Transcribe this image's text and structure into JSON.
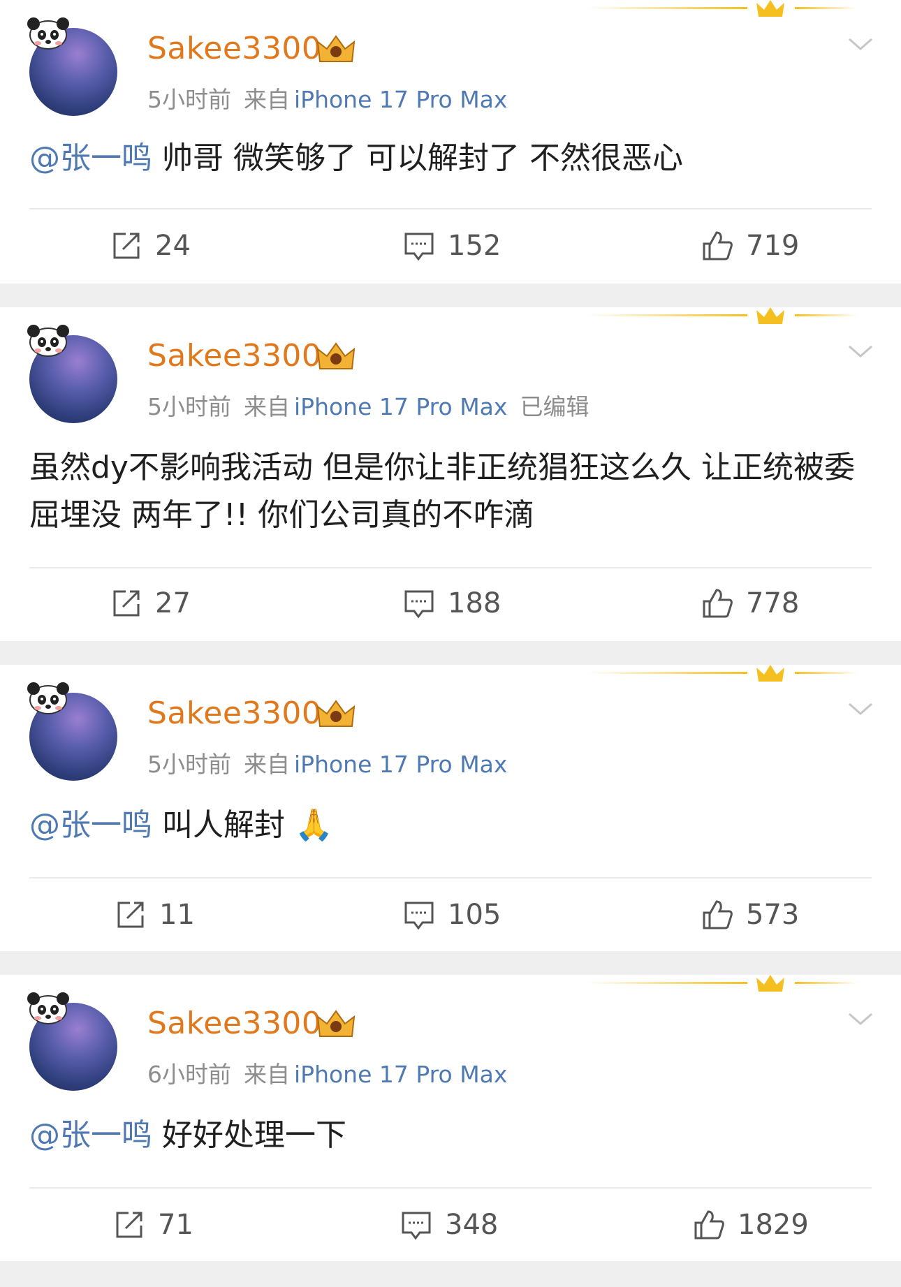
{
  "posts": [
    {
      "username": "Sakee3300",
      "time": "5小时前",
      "source_prefix": "来自",
      "device": "iPhone 17 Pro Max",
      "edited": "",
      "mention": "@张一鸣",
      "text": " 帅哥 微笑够了 可以解封了 不然很恶心",
      "reposts": "24",
      "comments": "152",
      "likes": "719"
    },
    {
      "username": "Sakee3300",
      "time": "5小时前",
      "source_prefix": "来自",
      "device": "iPhone 17 Pro Max",
      "edited": "已编辑",
      "mention": "",
      "text": "虽然dy不影响我活动 但是你让非正统猖狂这么久 让正统被委屈埋没 两年了!! 你们公司真的不咋滴",
      "reposts": "27",
      "comments": "188",
      "likes": "778"
    },
    {
      "username": "Sakee3300",
      "time": "5小时前",
      "source_prefix": "来自",
      "device": "iPhone 17 Pro Max",
      "edited": "",
      "mention": "@张一鸣",
      "text": " 叫人解封 🙏",
      "reposts": "11",
      "comments": "105",
      "likes": "573"
    },
    {
      "username": "Sakee3300",
      "time": "6小时前",
      "source_prefix": "来自",
      "device": "iPhone 17 Pro Max",
      "edited": "",
      "mention": "@张一鸣",
      "text": " 好好处理一下",
      "reposts": "71",
      "comments": "348",
      "likes": "1829"
    }
  ],
  "icons": {
    "repost": "repost-icon",
    "comment": "comment-icon",
    "like": "like-icon",
    "menu": "chevron-down-icon",
    "vip": "vip-crown-icon"
  },
  "colors": {
    "username": "#e2781c",
    "mention": "#4f79b2",
    "meta": "#8d8d8d",
    "banner": "#f5c01f"
  }
}
